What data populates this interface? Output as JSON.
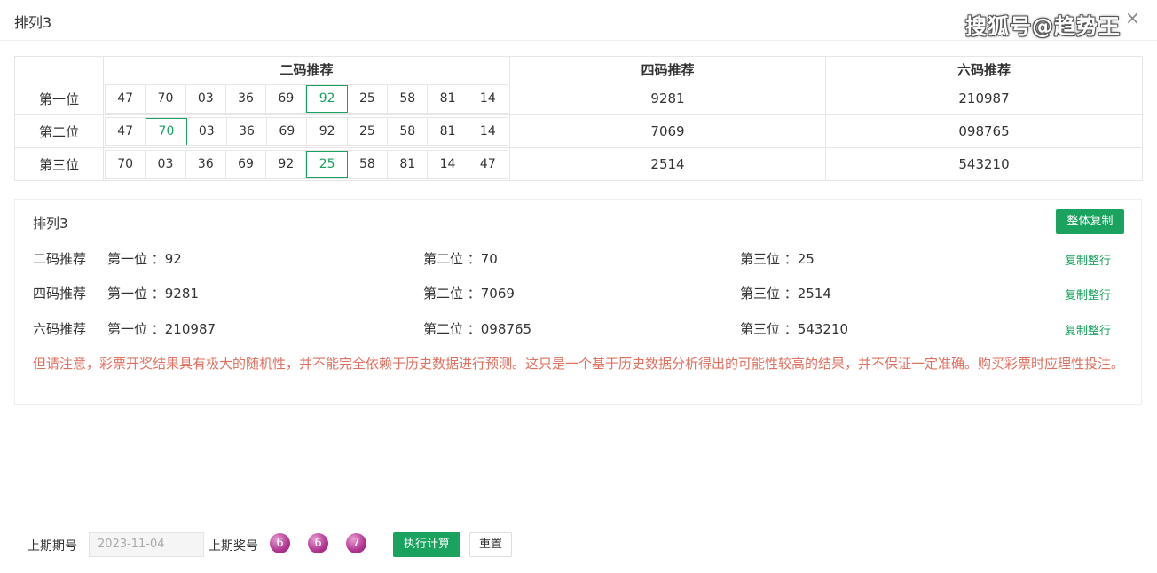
{
  "window": {
    "title": "排列3",
    "watermark": "搜狐号@趋势王",
    "close_icon": "×"
  },
  "table": {
    "headers": [
      "",
      "二码推荐",
      "四码推荐",
      "六码推荐"
    ],
    "rows": [
      {
        "position": "第一位",
        "two_code": [
          "47",
          "70",
          "03",
          "36",
          "69",
          "92",
          "25",
          "58",
          "81",
          "14"
        ],
        "highlight_index": 5,
        "four_code": "9281",
        "six_code": "210987"
      },
      {
        "position": "第二位",
        "two_code": [
          "47",
          "70",
          "03",
          "36",
          "69",
          "92",
          "25",
          "58",
          "81",
          "14"
        ],
        "highlight_index": 1,
        "four_code": "7069",
        "six_code": "098765"
      },
      {
        "position": "第三位",
        "two_code": [
          "70",
          "03",
          "36",
          "69",
          "92",
          "25",
          "58",
          "81",
          "14",
          "47"
        ],
        "highlight_index": 5,
        "four_code": "2514",
        "six_code": "543210"
      }
    ]
  },
  "summary": {
    "title": "排列3",
    "copy_all_label": "整体复制",
    "rows": [
      {
        "label": "二码推荐",
        "c1": "第一位 ：92",
        "c2": "第二位 ：70",
        "c3": "第三位 ：25",
        "copy": "复制整行"
      },
      {
        "label": "四码推荐",
        "c1": "第一位 ：9281",
        "c2": "第二位 ：7069",
        "c3": "第三位 ：2514",
        "copy": "复制整行"
      },
      {
        "label": "六码推荐",
        "c1": "第一位 ：210987",
        "c2": "第二位 ：098765",
        "c3": "第三位 ：543210",
        "copy": "复制整行"
      }
    ],
    "notice": "但请注意，彩票开奖结果具有极大的随机性，并不能完全依赖于历史数据进行预测。这只是一个基于历史数据分析得出的可能性较高的结果，并不保证一定准确。购买彩票时应理性投注。"
  },
  "footer": {
    "period_label": "上期期号",
    "period_value": "2023-11-04",
    "draw_label": "上期奖号",
    "draw_numbers": [
      "6",
      "6",
      "7"
    ],
    "execute_label": "执行计算",
    "reset_label": "重置"
  },
  "colors": {
    "accent": "#1aa35e",
    "notice": "#e0705f",
    "ball": "#b1348f"
  }
}
